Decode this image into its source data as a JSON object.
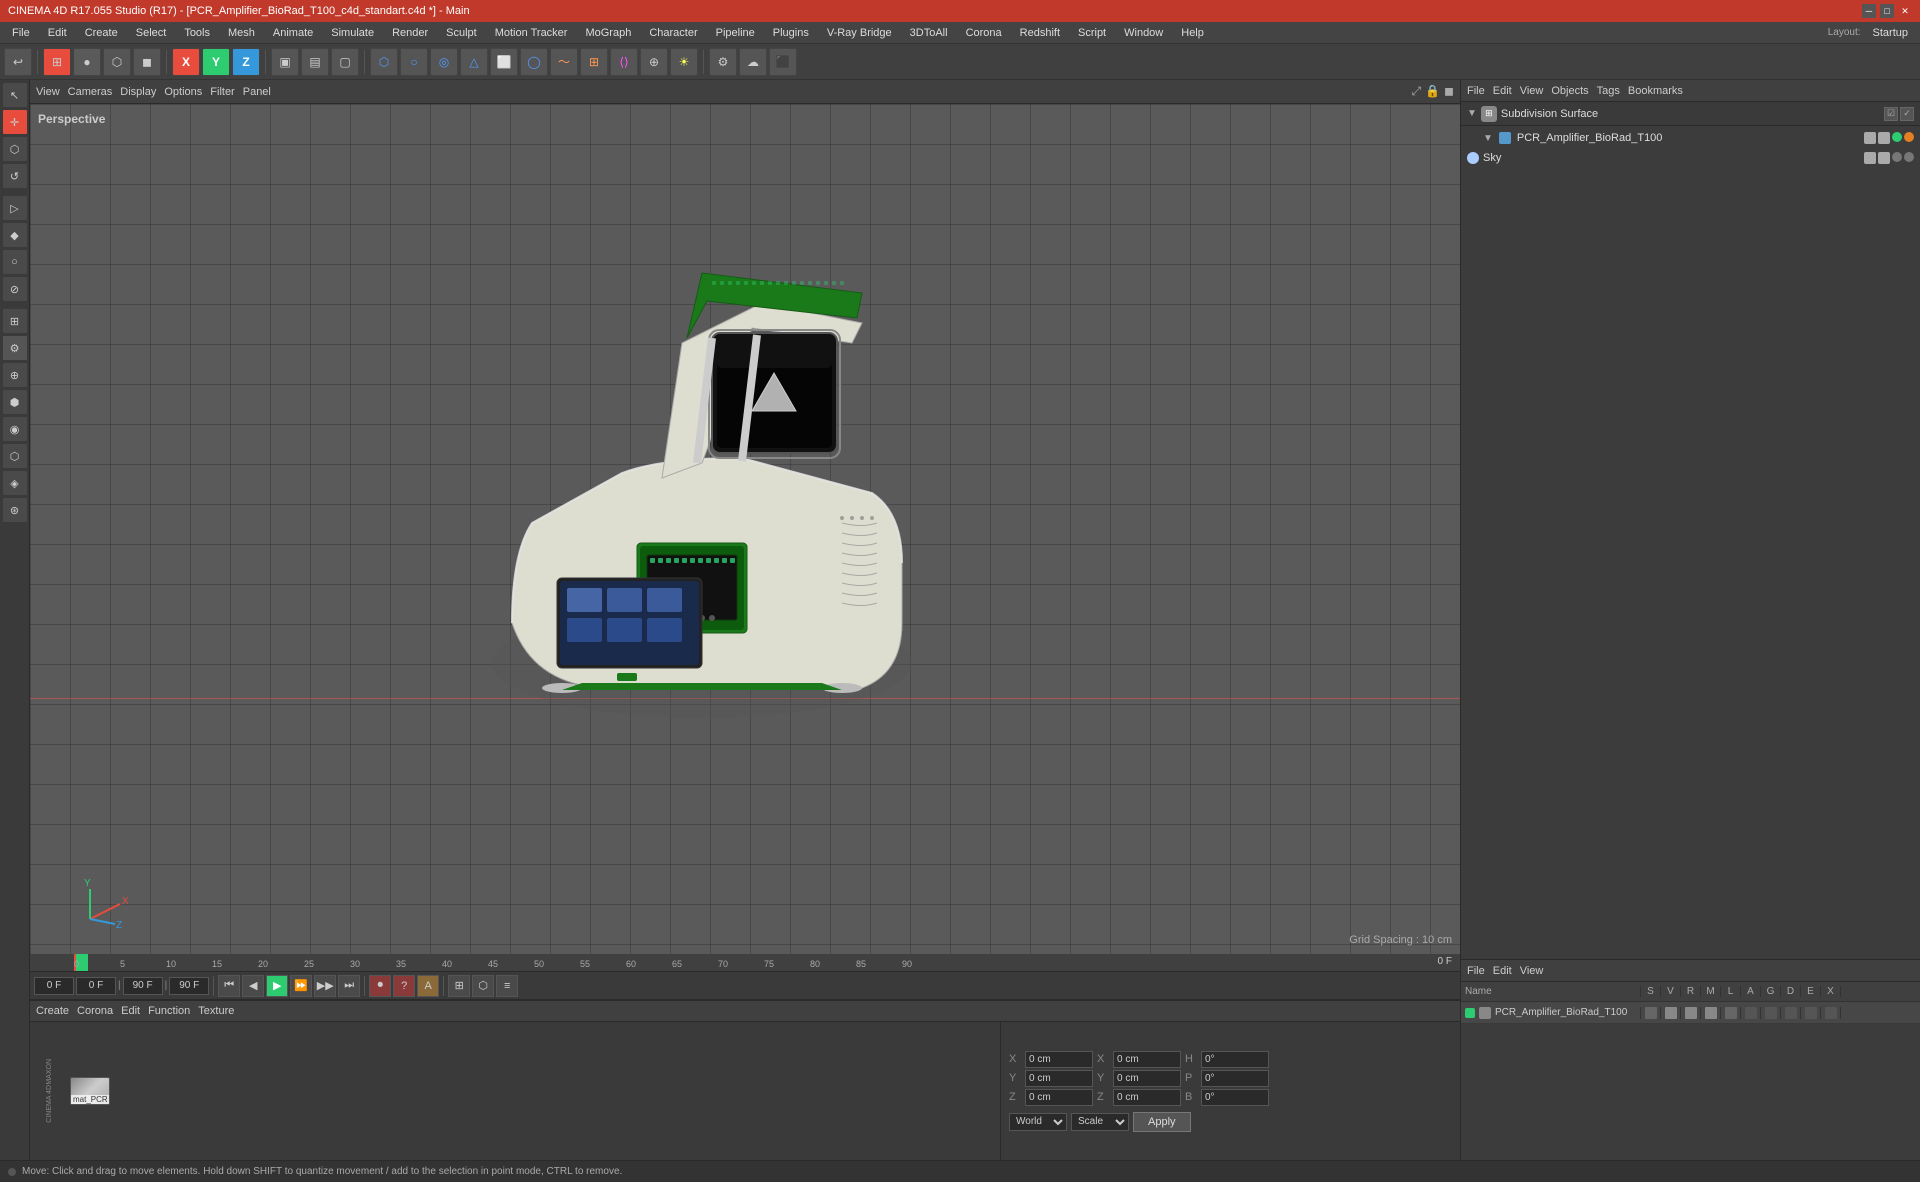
{
  "title_bar": {
    "text": "CINEMA 4D R17.055 Studio (R17) - [PCR_Amplifier_BioRad_T100_c4d_standart.c4d *] - Main",
    "minimize": "─",
    "maximize": "□",
    "close": "✕"
  },
  "menu_bar": {
    "items": [
      "File",
      "Edit",
      "Create",
      "Select",
      "Tools",
      "Mesh",
      "Animate",
      "Simulate",
      "Render",
      "Sculpt",
      "Motion Tracker",
      "MoGraph",
      "Character",
      "Pipeline",
      "Plugins",
      "V-Ray Bridge",
      "3DToAll",
      "Corona",
      "Redshift",
      "Script",
      "Window",
      "Help"
    ],
    "layout_label": "Layout:",
    "layout_value": "Startup"
  },
  "toolbar": {
    "buttons": [
      "↩",
      "▶",
      "⊞",
      "○",
      "✕",
      "X",
      "Y",
      "Z",
      "⬛",
      "▣",
      "▤",
      "▢",
      "⊕",
      "⊘",
      "◉",
      "⬡",
      "⚙",
      "☁",
      "⭐",
      "◆",
      "⬢",
      "⬡",
      "◉",
      "◯",
      "▶",
      "⏮",
      "⏯",
      "◼",
      "⚙",
      "☁"
    ]
  },
  "viewport": {
    "label": "Perspective",
    "grid_spacing": "Grid Spacing : 10 cm",
    "menus": [
      "View",
      "Cameras",
      "Display",
      "Options",
      "Filter",
      "Panel"
    ]
  },
  "object_manager": {
    "menus": [
      "File",
      "Edit",
      "View",
      "Objects",
      "Tags",
      "Bookmarks"
    ],
    "objects": [
      {
        "name": "Subdivision Surface",
        "type": "subdivision",
        "depth": 0,
        "expanded": true,
        "icons": [
          "check",
          "check"
        ]
      },
      {
        "name": "PCR_Amplifier_BioRad_T100",
        "type": "mesh",
        "depth": 1,
        "expanded": true,
        "icons": [
          "green",
          "orange"
        ]
      },
      {
        "name": "Sky",
        "type": "sky",
        "depth": 0,
        "expanded": false,
        "icons": [
          "gray",
          "gray"
        ]
      }
    ]
  },
  "attribute_manager": {
    "menus": [
      "File",
      "Edit",
      "View"
    ],
    "headers": [
      "Name",
      "S",
      "V",
      "R",
      "M",
      "L",
      "A",
      "G",
      "D",
      "E",
      "X"
    ],
    "row": {
      "color": "#2ecc71",
      "name": "PCR_Amplifier_BioRad_T100",
      "values": [
        "•",
        "•",
        "•",
        "•",
        "•",
        "•",
        "•",
        "•",
        "•",
        "•"
      ]
    }
  },
  "timeline": {
    "markers": [
      0,
      5,
      10,
      15,
      20,
      25,
      30,
      35,
      40,
      45,
      50,
      55,
      60,
      65,
      70,
      75,
      80,
      85,
      90
    ],
    "current_frame": "0 F",
    "start_frame": "0 F",
    "end_frame": "90 F",
    "fps": "90 F"
  },
  "material_bar": {
    "menus": [
      "Create",
      "Corona",
      "Edit",
      "Function",
      "Texture"
    ],
    "materials": [
      {
        "name": "mat_PCR",
        "type": "standard"
      }
    ]
  },
  "coordinates": {
    "x_pos": "0 cm",
    "y_pos": "0 cm",
    "z_pos": "0 cm",
    "x_size": "0 cm",
    "y_size": "0 cm",
    "z_size": "0 cm",
    "rot_h": "0°",
    "rot_p": "0°",
    "rot_b": "0°",
    "coord_system": "World",
    "transform_mode": "Scale",
    "apply_label": "Apply"
  },
  "status_bar": {
    "message": "Move: Click and drag to move elements. Hold down SHIFT to quantize movement / add to the selection in point mode, CTRL to remove."
  },
  "left_tools": [
    "↖",
    "⊞",
    "○",
    "⬡",
    "⊕",
    "◉",
    "⬢",
    "▷",
    "◆",
    "◯",
    "⊘",
    "↺",
    "⊛",
    "⬣",
    "⊕",
    "⬢",
    "◉",
    "⬡"
  ]
}
